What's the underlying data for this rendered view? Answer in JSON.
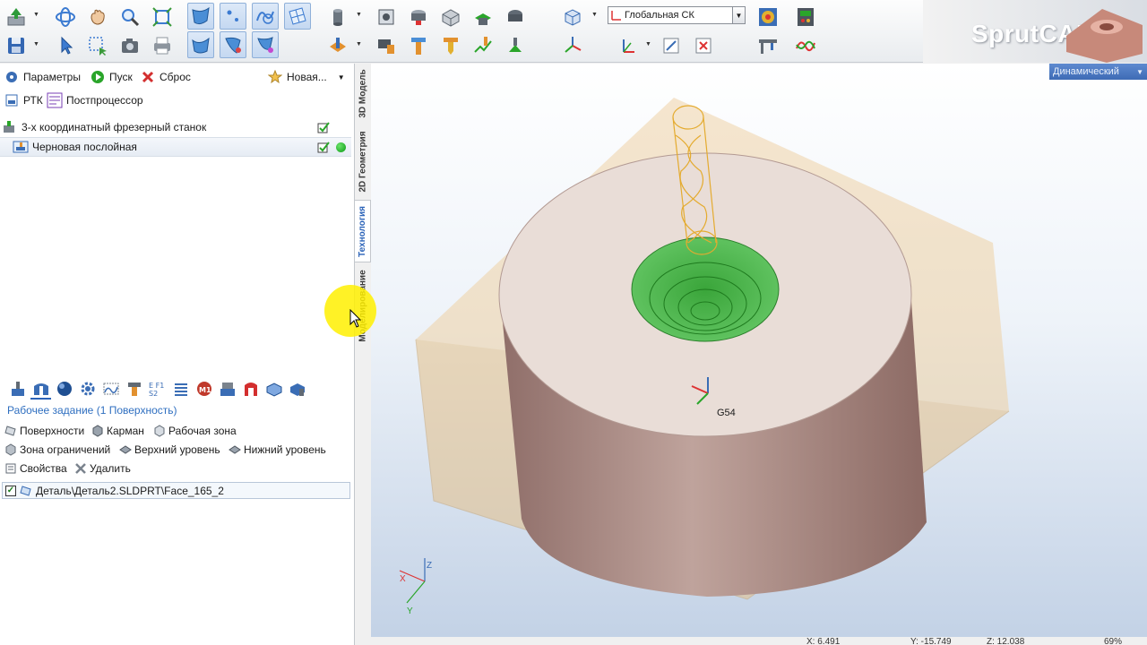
{
  "toolbar": {
    "coordinate_system": "Глобальная СК"
  },
  "brand": {
    "name": "SprutCAM"
  },
  "viewport": {
    "mode": "Динамический",
    "cs_label": "G54",
    "axes": {
      "x": "X",
      "y": "Y",
      "z": "Z"
    },
    "local_axes": {
      "x": "X",
      "y": "Y",
      "z": "Z"
    }
  },
  "colors": {
    "accent": "#2b63b8",
    "link": "#2f6fc0",
    "workpiece": "#b08e86",
    "stock": "#e7c48f",
    "toolpath": "#2aa52a",
    "status_ok": "#0a9a14"
  },
  "panel": {
    "commands": {
      "parameters": "Параметры",
      "run": "Пуск",
      "reset": "Сброс",
      "new": "Новая..."
    },
    "secondary": {
      "rtk": "РТК",
      "postprocessor": "Постпроцессор"
    },
    "tree": {
      "machine": "3-х координатный фрезерный станок",
      "operation": "Черновая послойная"
    },
    "tabs": [
      "3D Модель",
      "2D Геометрия",
      "Технология",
      "Моделирование"
    ],
    "job": {
      "title": "Рабочее задание",
      "count": "(1 Поверхность)",
      "buttons": {
        "surfaces": "Поверхности",
        "pocket": "Карман",
        "work_zone": "Рабочая зона",
        "restrict_zone": "Зона ограничений",
        "upper_level": "Верхний уровень",
        "lower_level": "Нижний уровень",
        "properties": "Свойства",
        "delete": "Удалить"
      },
      "items": [
        "Деталь\\Деталь2.SLDPRT\\Face_165_2"
      ]
    }
  },
  "status": {
    "x": "X: 6.491",
    "y": "Y: -15.749",
    "z": "Z: 12.038",
    "zoom": "69%"
  }
}
